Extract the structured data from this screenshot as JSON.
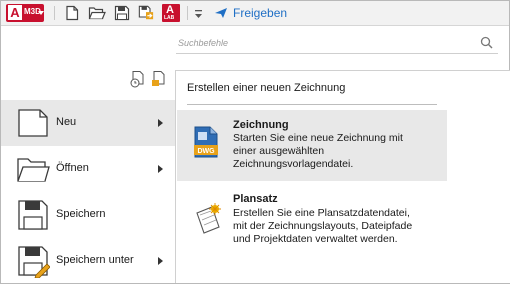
{
  "toolbar": {
    "app_badge": "M3D",
    "app_letter": "A",
    "share_label": "Freigeben",
    "lab_badge": "LAB"
  },
  "search": {
    "placeholder": "Suchbefehle"
  },
  "menu": {
    "items": [
      {
        "label": "Neu",
        "icon": "new-file-icon",
        "submenu": true,
        "selected": true
      },
      {
        "label": "Öffnen",
        "icon": "folder-open-icon",
        "submenu": true,
        "selected": false
      },
      {
        "label": "Speichern",
        "icon": "save-icon",
        "submenu": false,
        "selected": false
      },
      {
        "label": "Speichern unter",
        "icon": "save-as-icon",
        "submenu": true,
        "selected": false
      }
    ]
  },
  "panel": {
    "title": "Erstellen einer neuen Zeichnung",
    "options": [
      {
        "title": "Zeichnung",
        "lines": [
          "Starten Sie eine neue Zeichnung mit",
          "einer ausgewählten",
          "Zeichnungsvorlagendatei."
        ],
        "icon": "dwg-file-icon",
        "icon_label": "DWG",
        "selected": true
      },
      {
        "title": "Plansatz",
        "lines": [
          "Erstellen Sie eine Plansatzdatendatei,",
          "mit der Zeichnungslayouts, Dateipfade",
          "und Projektdaten verwaltet werden."
        ],
        "icon": "sheet-set-icon",
        "selected": false
      }
    ]
  },
  "colors": {
    "accent_red": "#c8102e",
    "share_blue": "#1f6fc5",
    "selection": "#e8e8e8"
  }
}
